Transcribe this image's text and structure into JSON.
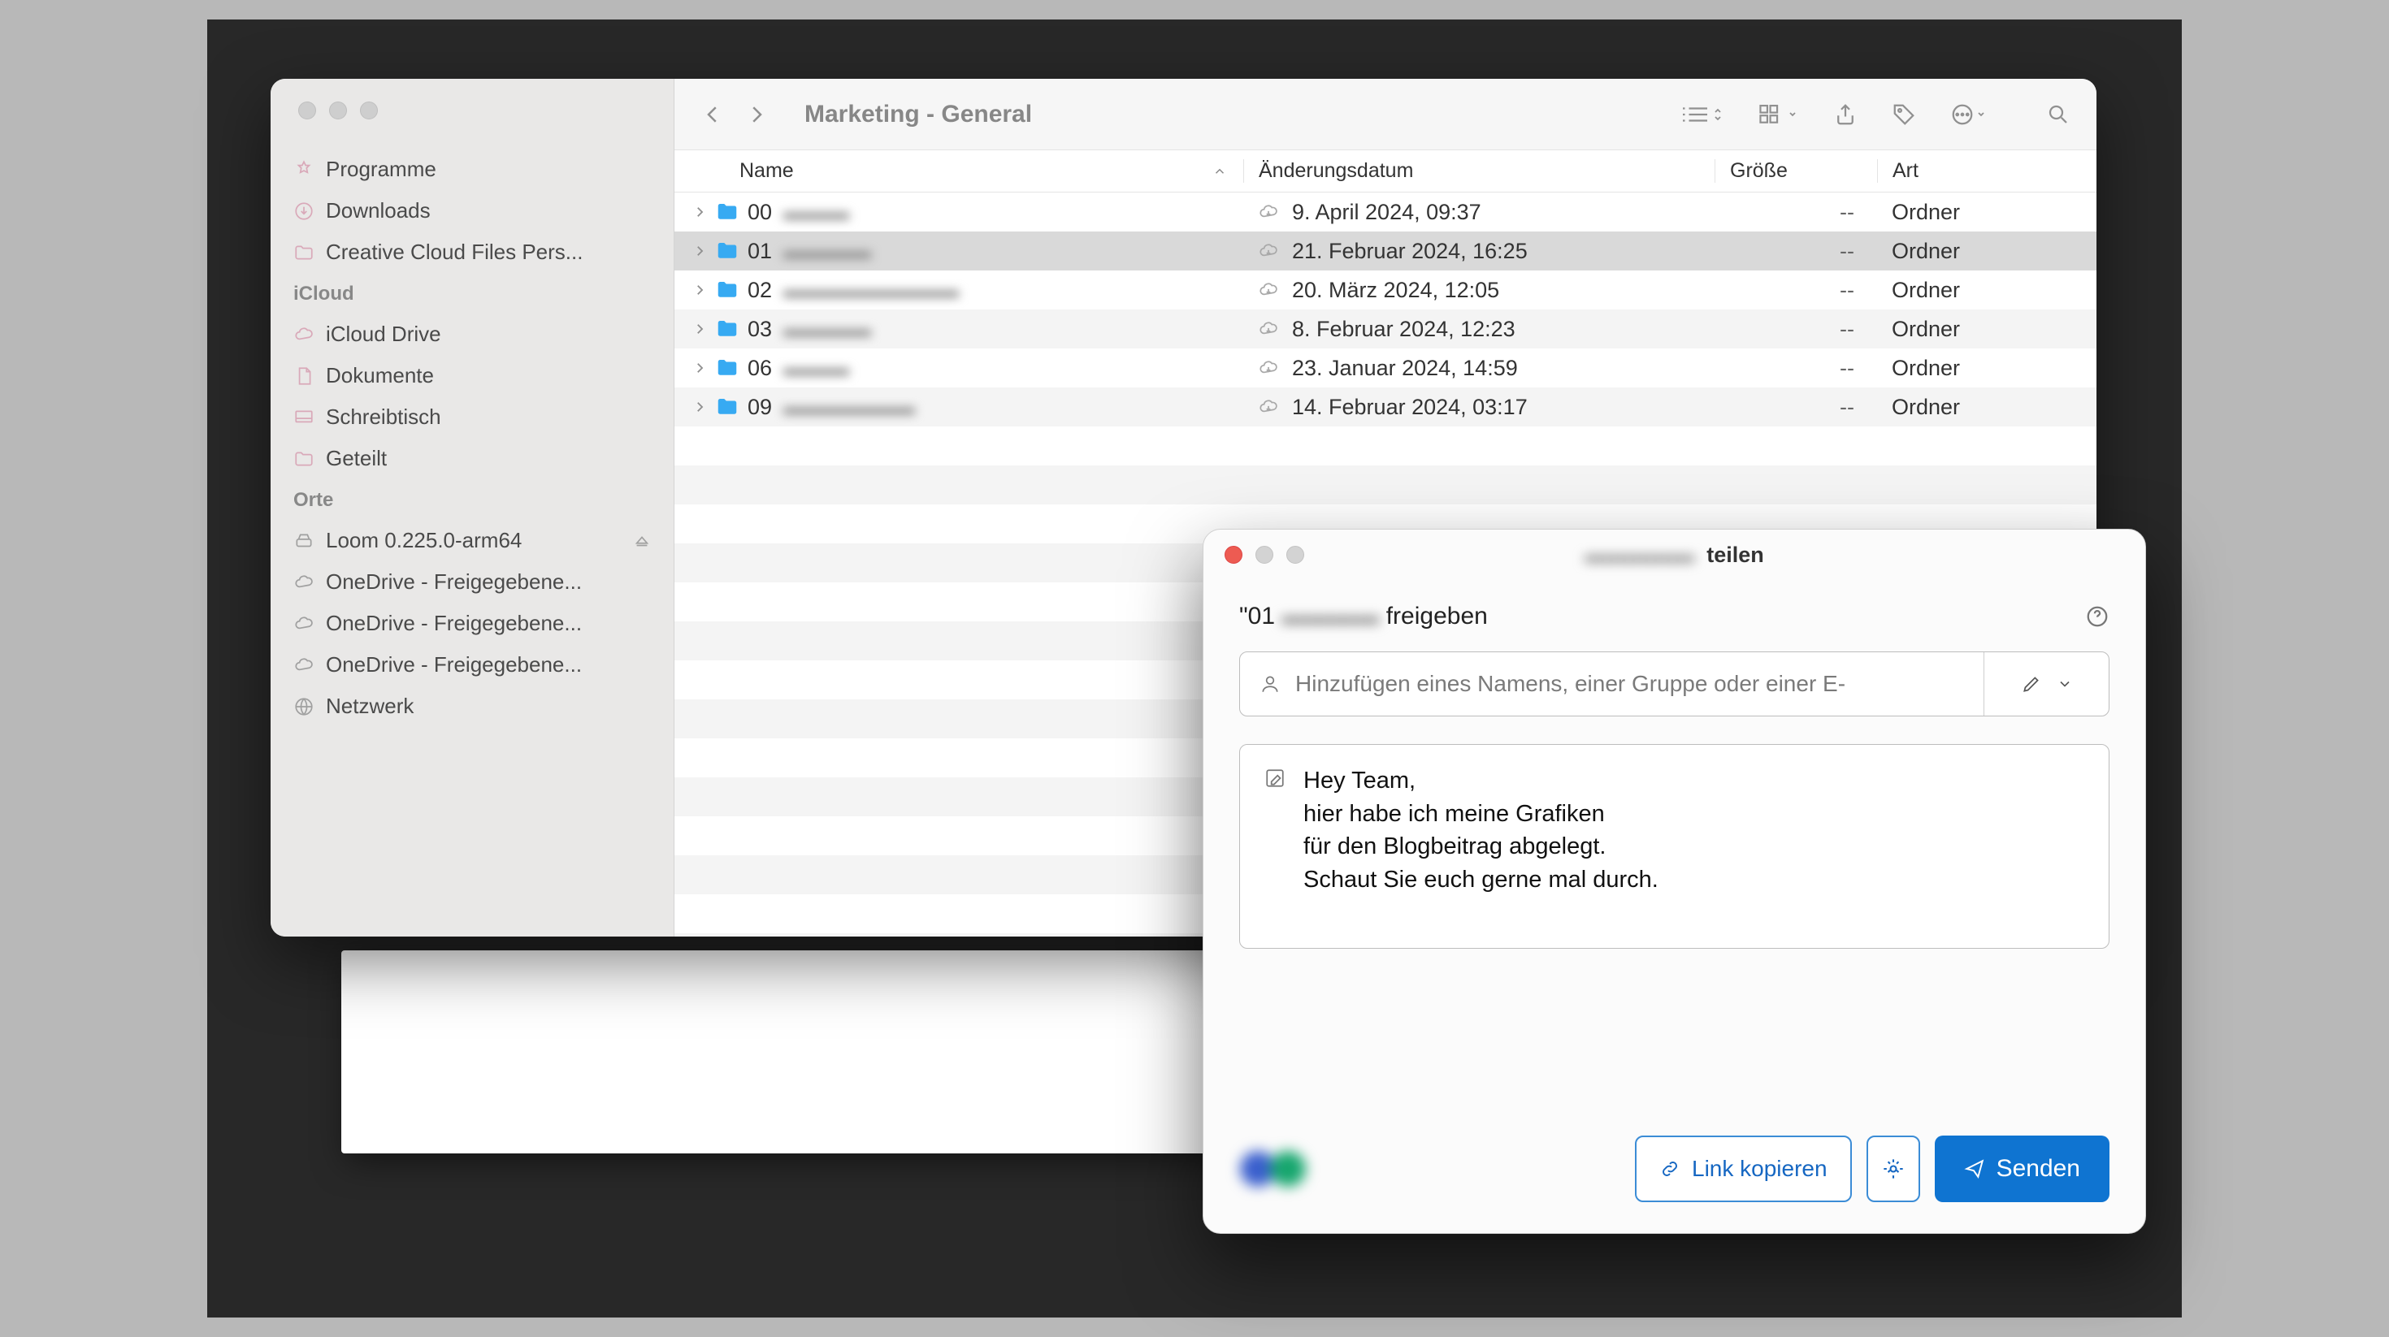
{
  "finder": {
    "title": "Marketing - General",
    "sidebar": {
      "favorites": [
        {
          "icon": "apps",
          "label": "Programme"
        },
        {
          "icon": "download",
          "label": "Downloads"
        },
        {
          "icon": "folder",
          "label": "Creative Cloud Files Pers..."
        }
      ],
      "groups": [
        {
          "label": "iCloud",
          "items": [
            {
              "icon": "cloud",
              "label": "iCloud Drive"
            },
            {
              "icon": "doc",
              "label": "Dokumente"
            },
            {
              "icon": "desktop",
              "label": "Schreibtisch"
            },
            {
              "icon": "shared",
              "label": "Geteilt"
            }
          ]
        },
        {
          "label": "Orte",
          "items": [
            {
              "icon": "disk",
              "label": "Loom 0.225.0-arm64",
              "eject": true
            },
            {
              "icon": "cloud",
              "label": "OneDrive - Freigegebene..."
            },
            {
              "icon": "cloud",
              "label": "OneDrive - Freigegebene..."
            },
            {
              "icon": "cloud",
              "label": "OneDrive - Freigegebene..."
            },
            {
              "icon": "globe",
              "label": "Netzwerk"
            }
          ]
        }
      ]
    },
    "columns": {
      "name": "Name",
      "modified": "Änderungsdatum",
      "size": "Größe",
      "kind": "Art"
    },
    "rows": [
      {
        "num": "00",
        "blur": "▬▬▬",
        "date": "9. April 2024, 09:37",
        "size": "--",
        "kind": "Ordner",
        "selected": false
      },
      {
        "num": "01",
        "blur": "▬▬▬▬",
        "date": "21. Februar 2024, 16:25",
        "size": "--",
        "kind": "Ordner",
        "selected": true
      },
      {
        "num": "02",
        "blur": "▬▬▬▬▬▬▬▬",
        "date": "20. März 2024, 12:05",
        "size": "--",
        "kind": "Ordner",
        "selected": false
      },
      {
        "num": "03",
        "blur": "▬▬▬▬",
        "date": "8. Februar 2024, 12:23",
        "size": "--",
        "kind": "Ordner",
        "selected": false
      },
      {
        "num": "06",
        "blur": "▬▬▬",
        "date": "23. Januar 2024, 14:59",
        "size": "--",
        "kind": "Ordner",
        "selected": false
      },
      {
        "num": "09",
        "blur": "▬▬▬▬▬▬",
        "date": "14. Februar 2024, 03:17",
        "size": "--",
        "kind": "Ordner",
        "selected": false
      }
    ]
  },
  "share": {
    "window_title_suffix": "teilen",
    "subtitle_prefix": "\"01",
    "subtitle_suffix": "freigeben",
    "name_placeholder": "Hinzufügen eines Namens, einer Gruppe oder einer E-",
    "message": "Hey Team,\nhier habe ich meine Grafiken\nfür den Blogbeitrag abgelegt.\nSchaut Sie euch gerne mal durch.",
    "copy_link": "Link kopieren",
    "send": "Senden"
  }
}
